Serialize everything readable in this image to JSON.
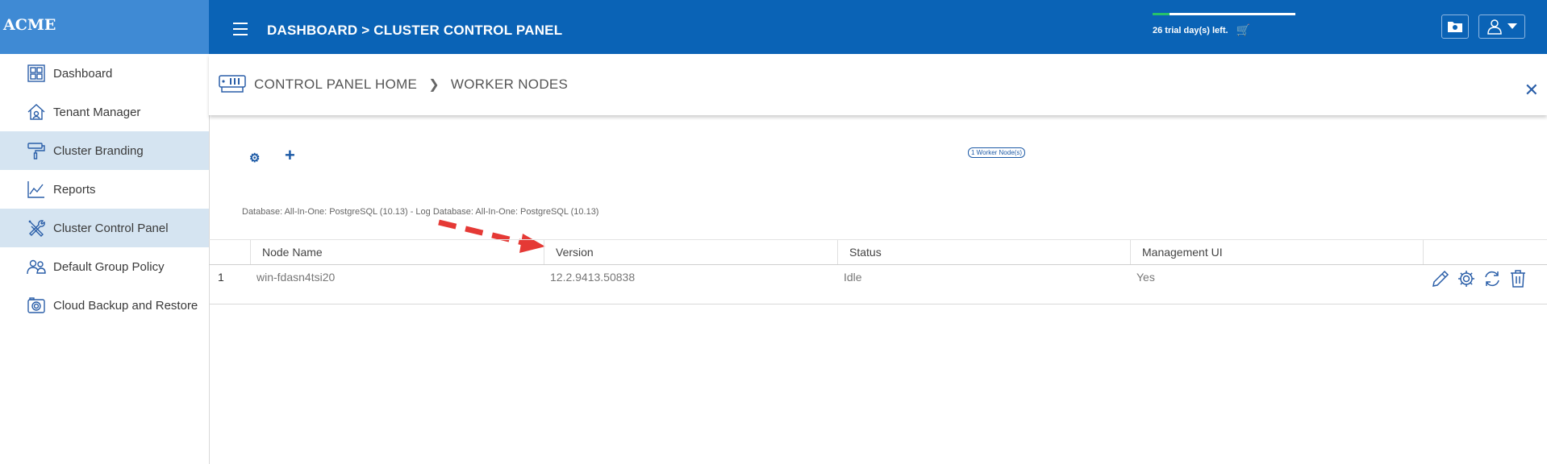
{
  "brand": "ACME",
  "sidebar": {
    "items": [
      {
        "label": "Dashboard",
        "icon": "dashboard-icon",
        "active": false
      },
      {
        "label": "Tenant Manager",
        "icon": "tenant-icon",
        "active": false
      },
      {
        "label": "Cluster Branding",
        "icon": "paint-roller-icon",
        "active": true
      },
      {
        "label": "Reports",
        "icon": "chart-icon",
        "active": false
      },
      {
        "label": "Cluster Control Panel",
        "icon": "tools-icon",
        "active": true
      },
      {
        "label": "Default Group Policy",
        "icon": "users-icon",
        "active": false
      },
      {
        "label": "Cloud Backup and Restore",
        "icon": "camera-icon",
        "active": false
      }
    ]
  },
  "topbar": {
    "title": "DASHBOARD > CLUSTER CONTROL PANEL",
    "trial_text": "26 trial day(s) left.",
    "trial_progress": 0.12,
    "accent": "#0a63b6"
  },
  "content_header": {
    "crumb_home": "CONTROL PANEL HOME",
    "crumb_current": "WORKER NODES"
  },
  "toolbar": {
    "node_count": "1 Worker Node(s)"
  },
  "db_info": "Database: All-In-One: PostgreSQL (10.13) - Log Database: All-In-One: PostgreSQL (10.13)",
  "table": {
    "headers": [
      "Node Name",
      "Version",
      "Status",
      "Management UI"
    ],
    "rows": [
      {
        "index": "1",
        "node_name": "win-fdasn4tsi20",
        "version": "12.2.9413.50838",
        "status": "Idle",
        "management_ui": "Yes"
      }
    ]
  }
}
